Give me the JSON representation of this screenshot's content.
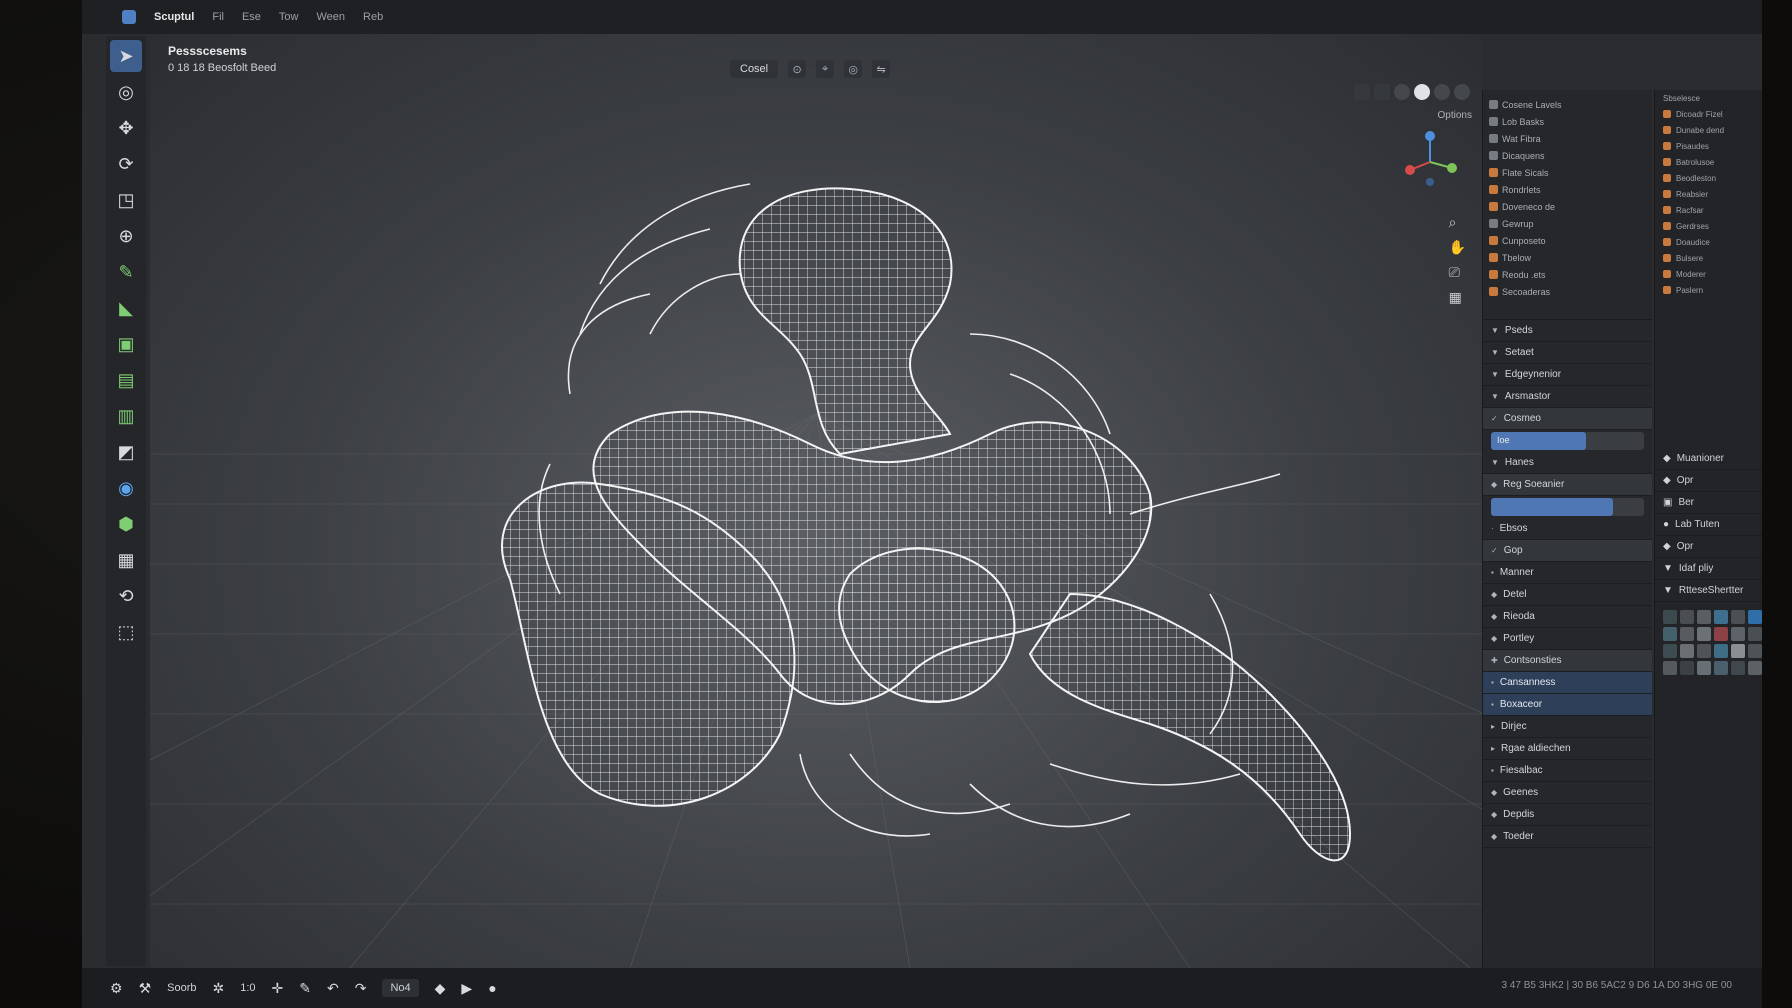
{
  "topbar": {
    "mode_label": "Scuptul",
    "menu_items": [
      "Fil",
      "Ese",
      "Tow",
      "Ween",
      "Reb"
    ]
  },
  "viewport": {
    "title": "Pessscesems",
    "subtitle": "0 18 18 Beosfolt Beed",
    "transform_label": "Cosel",
    "options_label": "Options"
  },
  "statusbar": {
    "left_label": "Soorb",
    "coord_label": "1:0",
    "frame_label": "No4",
    "info_text": "3 47 B5 3HK2 | 30 B6 5AC2 9 D6 1A D0 3HG 0E 00"
  },
  "outliner": {
    "rows": [
      "Cosene Lavels",
      "Lob Basks",
      "Wat Fibra",
      "Dicaquens",
      "Flate Sicals",
      "Rondrlets",
      "Doveneco de",
      "Gewrup",
      "Cunposeto",
      "Tbelow",
      "Reodu .ets",
      "Secoaderas"
    ]
  },
  "properties": {
    "sections": [
      {
        "label": "Pseds",
        "style": "plain"
      },
      {
        "label": "Setaet",
        "style": "plain"
      },
      {
        "label": "Edgeynenior",
        "style": "plain"
      },
      {
        "label": "Arsmastor",
        "style": "plain"
      },
      {
        "label": "Cosmeo",
        "style": "sub"
      }
    ],
    "slider_a": {
      "label": "Ioe",
      "value": 0.62
    },
    "hanes_label": "Hanes",
    "reg_label": "Reg Soeanier",
    "slider_b": {
      "label": "",
      "value": 0.8
    },
    "extra_rows": [
      "Ebsos",
      "Gop",
      "Manner"
    ],
    "lower_sections": [
      "Detel",
      "Rieoda",
      "Portley",
      "Contsonsties"
    ],
    "highlight_rows": [
      "Cansanness",
      "Boxaceor"
    ],
    "tree_rows": [
      "Dirjec",
      "Rgae aldiechen",
      "Fiesalbac"
    ],
    "bottom_sections": [
      "Geenes",
      "Depdis",
      "Toeder"
    ]
  },
  "panel2": {
    "header": "Sbselesce",
    "rows": [
      "Dicoadr Fizel",
      "Dunabe dend",
      "Pisaudes",
      "Batrolusoe",
      "Beodleston",
      "Reabsier",
      "Racfsar",
      "Gerdrses",
      "Doaudice",
      "Bulsere",
      "Moderer",
      "Paslern"
    ],
    "items": [
      "Muanioner",
      "Opr",
      "Ber",
      "Lab Tuten",
      "Opr"
    ],
    "tree_label": "Idaf pliy",
    "section_label": "RtteseShertter",
    "swatch_colors": [
      "#3c4a4f",
      "#4a4e52",
      "#5a5f63",
      "#3f6f8f",
      "#4b5054",
      "#2f6fa8",
      "#44606a",
      "#575b60",
      "#6d7276",
      "#8c4147",
      "#5d6368",
      "#4a4f54",
      "#3d4c52",
      "#6b6f73",
      "#505458",
      "#3e6d86",
      "#8a8f94",
      "#4e5358",
      "#555a5f",
      "#3b4145",
      "#687076",
      "#4a5e6c",
      "#41484d",
      "#5c6166"
    ]
  }
}
